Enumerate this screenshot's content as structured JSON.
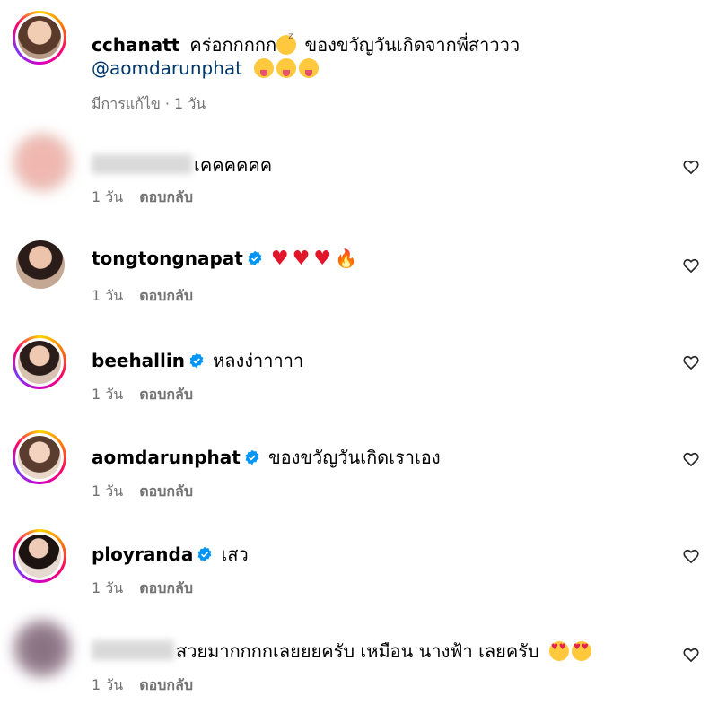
{
  "caption": {
    "username": "cchanatt",
    "text": "คร่อกกกกก",
    "text2": " ของขวัญวันเกิดจากพี่สาววว",
    "mention": "@aomdarunphat",
    "meta": "มีการแก้ไข · 1 วัน"
  },
  "comments": [
    {
      "username": "",
      "text": "เคคคคคค",
      "time": "1 วัน",
      "reply": "ตอบกลับ"
    },
    {
      "username": "tongtongnapat",
      "text": "",
      "time": "1 วัน",
      "reply": "ตอบกลับ"
    },
    {
      "username": "beehallin",
      "text": "หลงง่าาาาา",
      "time": "1 วัน",
      "reply": "ตอบกลับ"
    },
    {
      "username": "aomdarunphat",
      "text": "ของขวัญวันเกิดเราเอง",
      "time": "1 วัน",
      "reply": "ตอบกลับ"
    },
    {
      "username": "ployranda",
      "text": "เสว",
      "time": "1 วัน",
      "reply": "ตอบกลับ"
    },
    {
      "username": "",
      "text": "สวยมากกกกเลยยยครับ เหมือน นางฟ้า เลยครับ",
      "time": "1 วัน",
      "reply": "ตอบกลับ"
    }
  ],
  "colors": {
    "meta": "#737373",
    "mention": "#00376b",
    "verified": "#0095f6"
  },
  "icons": [
    "like-heart-icon",
    "verified-badge-icon"
  ]
}
